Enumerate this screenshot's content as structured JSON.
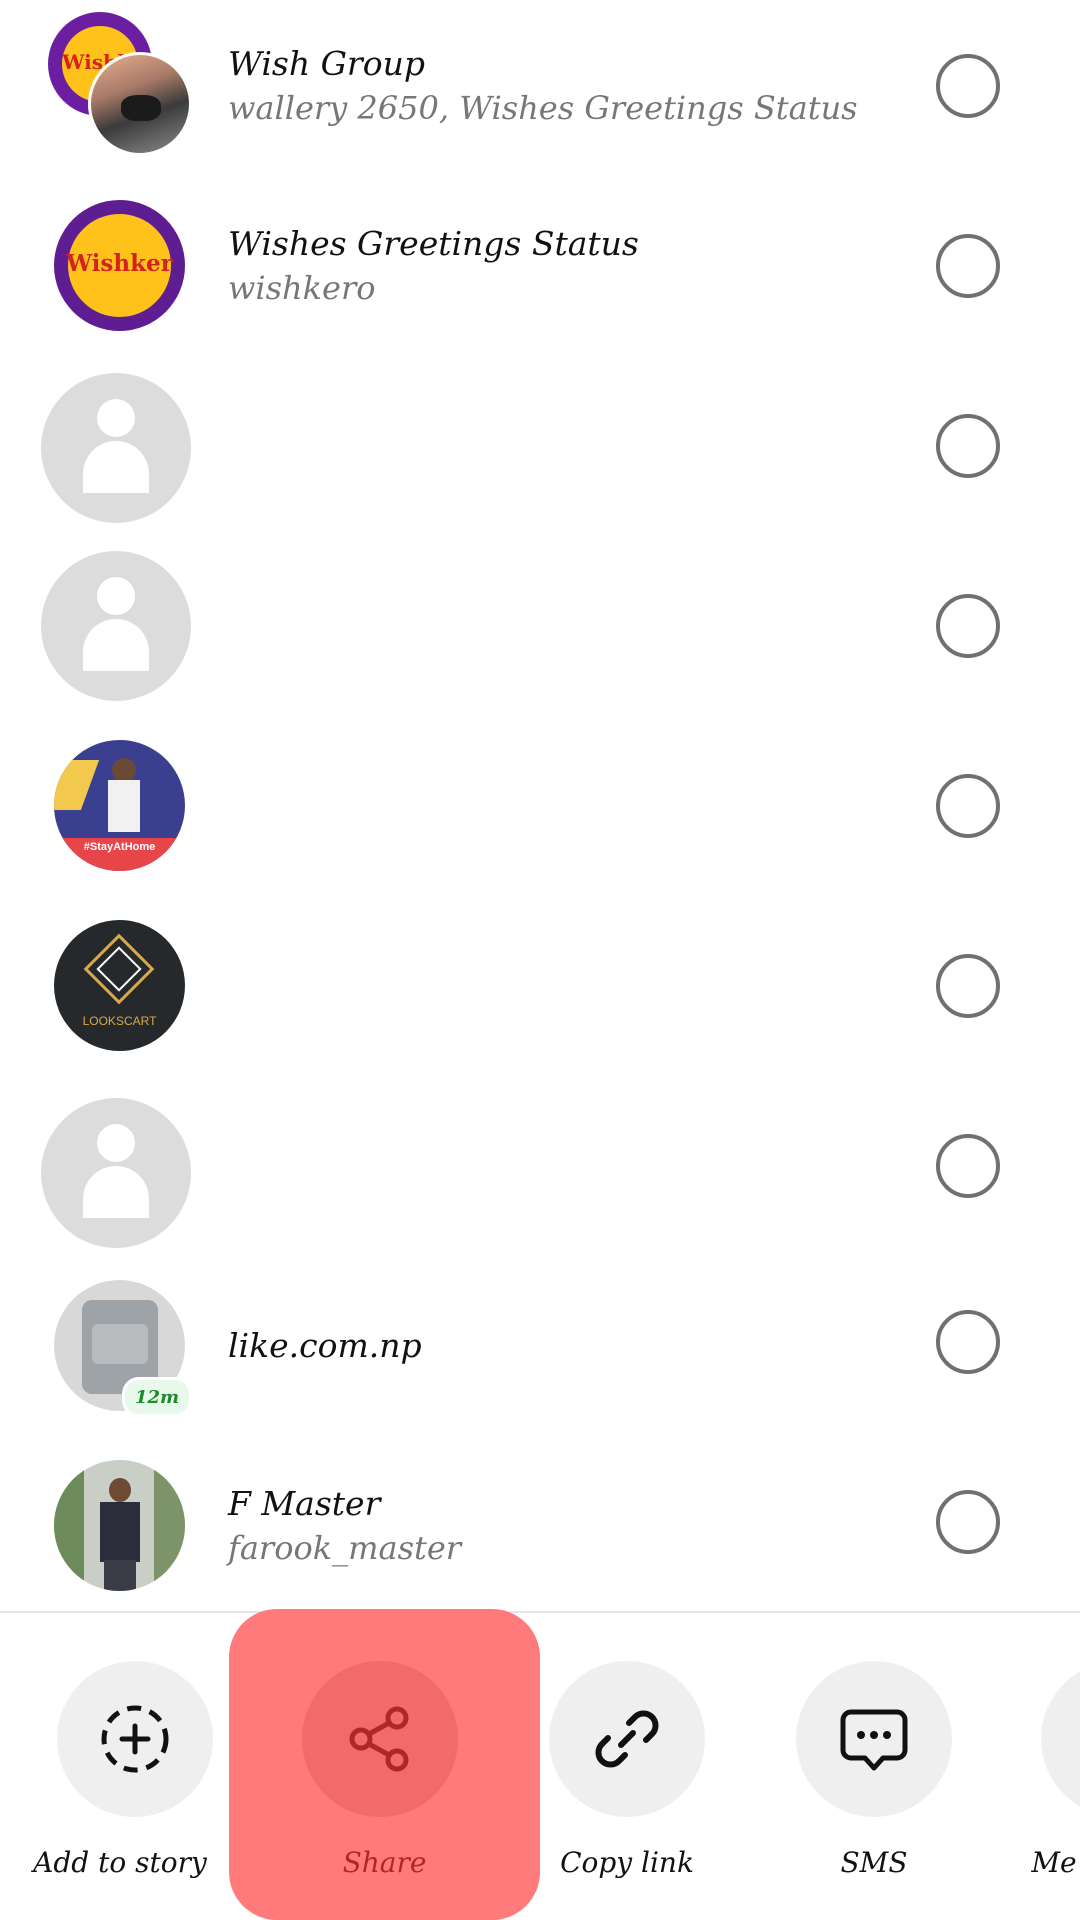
{
  "contacts": [
    {
      "name": "Wish Group",
      "subtitle": "wallery 2650, Wishes Greetings Status",
      "avatar": "group-avatar",
      "selected": false
    },
    {
      "name": "Wishes Greetings Status",
      "subtitle": "wishkero",
      "avatar": "wishker-logo",
      "logo_text": "Wishker",
      "selected": false
    },
    {
      "name": "",
      "subtitle": "",
      "avatar": "default-person-icon",
      "selected": false
    },
    {
      "name": "",
      "subtitle": "",
      "avatar": "default-person-icon",
      "selected": false
    },
    {
      "name": "",
      "subtitle": "",
      "avatar": "photo-stay-at-home",
      "banner_text": "#StayAtHome",
      "selected": false
    },
    {
      "name": "",
      "subtitle": "",
      "avatar": "lookscart-logo",
      "logo_text": "LOOKSCART",
      "selected": false
    },
    {
      "name": "",
      "subtitle": "",
      "avatar": "default-person-icon",
      "selected": false
    },
    {
      "name": "like.com.np",
      "subtitle": "",
      "avatar": "photo-bag",
      "badge": "12m",
      "selected": false
    },
    {
      "name": "F Master",
      "subtitle": "farook_master",
      "avatar": "photo-person",
      "selected": false
    }
  ],
  "actions": [
    {
      "label": "Add to story",
      "icon": "add-story-icon"
    },
    {
      "label": "Share",
      "icon": "share-icon",
      "highlighted": true
    },
    {
      "label": "Copy link",
      "icon": "link-icon"
    },
    {
      "label": "SMS",
      "icon": "sms-icon"
    },
    {
      "label": "Me",
      "icon": "more-icon"
    }
  ],
  "colors": {
    "highlight": "#ff7b7b",
    "share_label": "#b22626",
    "radio_border": "#707070",
    "action_circle": "#efefef"
  }
}
